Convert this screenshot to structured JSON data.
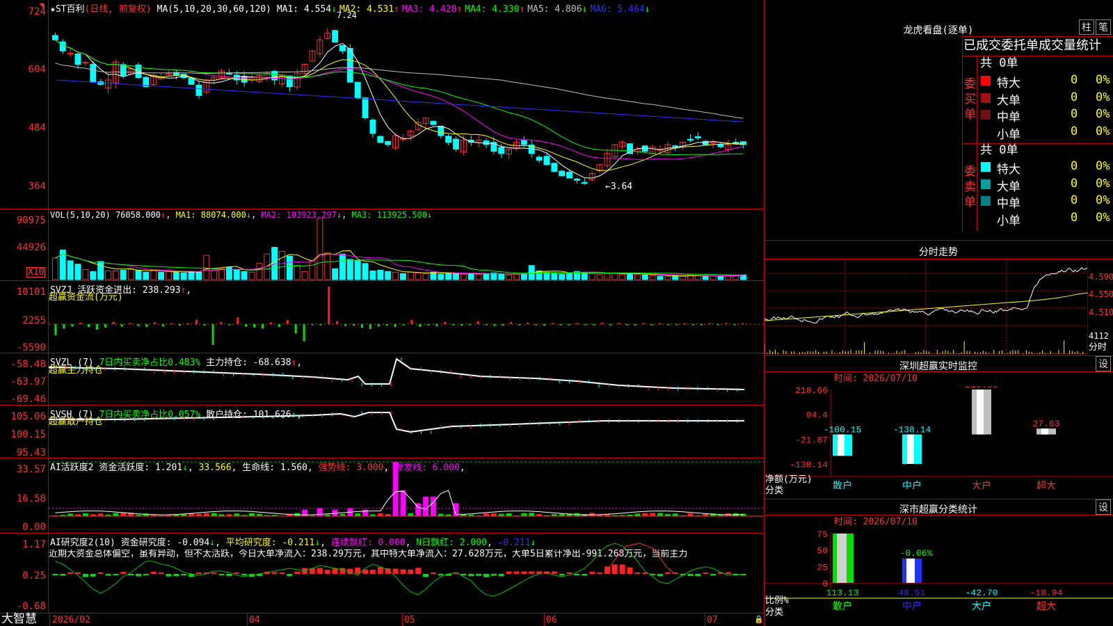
{
  "stock_title": "★ST百利",
  "period_label": "(日线, 前复权)",
  "main_ma_params": "MA(5,10,20,30,60,120)",
  "main_mas": [
    {
      "label": "MA1:",
      "value": "4.554",
      "arrow": "↓",
      "color": "#ffffff"
    },
    {
      "label": "MA2:",
      "value": "4.531",
      "arrow": "↑",
      "color": "#ffff00"
    },
    {
      "label": "MA3:",
      "value": "4.428",
      "arrow": "↑",
      "color": "#ff00ff"
    },
    {
      "label": "MA4:",
      "value": "4.330",
      "arrow": "↑",
      "color": "#00ff00"
    },
    {
      "label": "MA5:",
      "value": "4.806",
      "arrow": "↓",
      "color": "#c0c0c0"
    },
    {
      "label": "MA6:",
      "value": "5.464",
      "arrow": "↓",
      "color": "#3030ff"
    }
  ],
  "high_mark": "7.24",
  "low_mark": "3.64",
  "price_axis": [
    "724",
    "604",
    "484",
    "364"
  ],
  "vol_legend": {
    "name": "VOL(5,10,20)",
    "value": "76058.000",
    "arrow": "↑",
    "ma1": "MA1: 88074.000",
    "ma1_arrow": "↓",
    "ma2": "MA2: 103923.297",
    "ma2_arrow": "↓",
    "ma3": "MA3: 113925.500",
    "ma3_arrow": "↓"
  },
  "vol_axis": [
    "90975",
    "44926"
  ],
  "vol_scale_label": "X10",
  "svzj": {
    "name": "SVZJ",
    "desc": "活跃资金进出: 238.293",
    "arrow": "↑",
    "subtitle": "超赢资金流(万元)",
    "axis": [
      "10101",
      "2255",
      "-5590"
    ]
  },
  "svzl": {
    "name": "SVZL  (7)",
    "desc1": "7日内买卖净占比0.483%",
    "desc2": "主力持仓: -68.638",
    "arrow": "↑",
    "subtitle": "超赢主力持仓",
    "axis": [
      "-58.48",
      "-63.97",
      "-69.46"
    ]
  },
  "svsh": {
    "name": "SVSH  (7)",
    "desc1": "7日内买卖净占比0.057%",
    "desc2": "散户持仓: 101.626",
    "arrow": "↓",
    "subtitle": "超赢散户持仓",
    "axis": [
      "105.06",
      "100.15",
      "95.43"
    ]
  },
  "ai2": {
    "name": "AI活跃度2",
    "l1": "资金活跃度: 1.201",
    "l1_arrow": "↓",
    "l2": "33.566",
    "l3": "生命线: 1.560",
    "l4": "强势线: 3.000",
    "l5": "爆发线: 6.000",
    "axis": [
      "33.57",
      "16.58",
      "0.00"
    ]
  },
  "ai_research": {
    "name": "AI研究度2(10)",
    "l1": "资金研究度: -0.094",
    "l1_arrow": "↓",
    "l2": "平均研究度: -0.211",
    "l2_arrow": "↓",
    "l3": "连续飘红: 0.000",
    "l4": "N日飘红: 2.000",
    "l5": "-0.211",
    "l5_arrow": "↓",
    "comment": "近期大资金总体偏空，虽有异动，但不太活跃，今日大单净流入：238.29万元，其中特大单净流入：27.628万元，大单5日累计净出-991.268万元，当前主力",
    "axis": [
      "1.17",
      "0.25",
      "-0.68"
    ]
  },
  "bottom_axis": {
    "logo": "大智慧",
    "dates": [
      "2026/02",
      "04",
      "05",
      "06",
      "07"
    ]
  },
  "dragon": {
    "title": "龙虎看盘(逐单)",
    "btn1": "柱",
    "btn2": "笔",
    "header": "已成交委托单成交量统计",
    "buy_label": "委买单",
    "sell_label": "委卖单",
    "buy_total": "共 0单",
    "sell_total": "共 0单",
    "buy_rows": [
      {
        "name": "特大",
        "v": "0",
        "p": "0%",
        "color": "#ff0000"
      },
      {
        "name": "大单",
        "v": "0",
        "p": "0%",
        "color": "#a01010"
      },
      {
        "name": "中单",
        "v": "0",
        "p": "0%",
        "color": "#701010"
      },
      {
        "name": "小单",
        "v": "0",
        "p": "0%",
        "color": ""
      }
    ],
    "sell_rows": [
      {
        "name": "特大",
        "v": "0",
        "p": "0%",
        "color": "#00ffff"
      },
      {
        "name": "大单",
        "v": "0",
        "p": "0%",
        "color": "#00a0a0"
      },
      {
        "name": "中单",
        "v": "0",
        "p": "0%",
        "color": "#008080"
      },
      {
        "name": "小单",
        "v": "0",
        "p": "0%",
        "color": ""
      }
    ]
  },
  "intraday": {
    "title": "分时走势",
    "axis": [
      "4.590",
      "4.550",
      "4.510"
    ],
    "vol_label": "4112",
    "vol_unit": "分时"
  },
  "monitor": {
    "title": "深圳超赢实时监控",
    "btn": "设",
    "time": "时间: 2026/07/10",
    "axis": [
      "210.66",
      "94.4",
      "-21.87",
      "-138.14"
    ],
    "unit_label": "净额(万元)",
    "cat_label": "分类",
    "categories": [
      "散户",
      "中户",
      "大户",
      "超大"
    ],
    "values": [
      "-100.15",
      "-138.14",
      "210.66",
      "27.63"
    ]
  },
  "classify": {
    "title": "深市超赢分类统计",
    "btn": "设",
    "time": "时间: 2026/07/10",
    "axis": [
      "75",
      "50",
      "25",
      "0"
    ],
    "mid_label": "-0.06%",
    "unit_label": "比例%",
    "cat_label": "分类",
    "categories": [
      "散户",
      "中户",
      "大户",
      "超大"
    ],
    "values": [
      "113.13",
      "48.51",
      "-42.70",
      "-18.94"
    ]
  },
  "chart_data": [
    {
      "type": "candlestick",
      "title": "★ST百利 (日线, 前复权)",
      "ylim": [
        3.5,
        7.4
      ],
      "y_ticks": [
        7.24,
        6.04,
        4.84,
        3.64
      ],
      "annotations": [
        {
          "text": "7.24",
          "kind": "high"
        },
        {
          "text": "3.64",
          "kind": "low"
        }
      ],
      "close": [
        6.85,
        6.6,
        6.55,
        6.3,
        6.35,
        5.9,
        5.85,
        5.95,
        6.35,
        6.05,
        6.2,
        6.0,
        5.8,
        6.05,
        6.0,
        6.1,
        6.05,
        6.0,
        5.85,
        5.6,
        5.95,
        6.0,
        6.15,
        6.1,
        5.95,
        5.9,
        6.0,
        6.05,
        6.1,
        5.95,
        6.05,
        5.8,
        6.1,
        6.3,
        6.6,
        6.85,
        7.0,
        6.8,
        6.6,
        5.9,
        5.55,
        5.1,
        4.75,
        4.55,
        4.5,
        4.7,
        4.65,
        4.8,
        5.0,
        5.1,
        4.95,
        4.7,
        4.55,
        4.4,
        4.6,
        4.55,
        4.6,
        4.5,
        4.35,
        4.3,
        4.4,
        4.55,
        4.5,
        4.3,
        4.15,
        4.05,
        3.9,
        3.8,
        3.75,
        3.7,
        3.64,
        3.85,
        4.05,
        4.3,
        4.5,
        4.55,
        4.3,
        4.4,
        4.35,
        4.45,
        4.4,
        4.5,
        4.45,
        4.55,
        4.6,
        4.65,
        4.5,
        4.55,
        4.45,
        4.5,
        4.55,
        4.5
      ]
    },
    {
      "type": "bar",
      "title": "VOL(5,10,20)",
      "values": [
        32000,
        44000,
        28000,
        23000,
        15000,
        12000,
        27000,
        13000,
        13000,
        14000,
        15000,
        14000,
        11000,
        14000,
        11000,
        12000,
        11000,
        10000,
        12000,
        11000,
        36000,
        14000,
        16000,
        18000,
        14000,
        12000,
        11000,
        24000,
        38000,
        48000,
        42000,
        35000,
        21000,
        12000,
        28000,
        91000,
        40000,
        16000,
        38000,
        30000,
        28000,
        24000,
        13000,
        14000,
        12000,
        11000,
        9000,
        11000,
        10000,
        9000,
        11000,
        8000,
        10000,
        9000,
        8000,
        9000,
        8000,
        9000,
        10000,
        8000,
        7000,
        8000,
        9000,
        21000,
        13000,
        11000,
        9000,
        8000,
        10000,
        12000,
        11000,
        9000,
        8000,
        9000,
        10000,
        8000,
        9000,
        8000,
        7000,
        6000,
        5000,
        5000,
        6000,
        5000,
        7000,
        6000,
        5000,
        6000,
        5000,
        7000,
        6000,
        7000
      ],
      "ylim": [
        0,
        95000
      ],
      "y_ticks": [
        90975,
        44926
      ]
    },
    {
      "type": "bar",
      "title": "超赢资金流(万元)",
      "values": [
        -3000,
        -1200,
        -600,
        400,
        -800,
        -1500,
        -900,
        600,
        -700,
        300,
        -500,
        -800,
        500,
        -600,
        300,
        -400,
        200,
        1200,
        -400,
        -5590,
        600,
        -300,
        1800,
        -700,
        -900,
        -1200,
        500,
        -800,
        1100,
        -2500,
        -4600,
        -200,
        -300,
        10101,
        800,
        -500,
        -400,
        -1000,
        -1300,
        -600,
        -400,
        -800,
        -300,
        1100,
        -700,
        -300,
        -500,
        600,
        -300,
        -400,
        -200,
        800,
        -300,
        -500,
        -400,
        600,
        -300,
        400,
        -200,
        -400,
        300,
        -300,
        -200,
        300,
        -200,
        -300,
        400,
        -200,
        300,
        -200,
        -300,
        200,
        -200,
        300,
        -200,
        -100,
        200,
        -200,
        -300,
        200,
        -100,
        200,
        -100,
        238
      ],
      "ylim": [
        -5590,
        10101
      ]
    },
    {
      "type": "line",
      "title": "超赢主力持仓",
      "ylim": [
        -69.46,
        -58.48
      ]
    },
    {
      "type": "line",
      "title": "超赢散户持仓",
      "ylim": [
        95.43,
        105.06
      ]
    },
    {
      "type": "bar",
      "title": "AI活跃度2",
      "ylim": [
        0,
        33.57
      ]
    },
    {
      "type": "bar",
      "title": "AI研究度2(10)",
      "ylim": [
        -0.68,
        1.17
      ]
    },
    {
      "type": "bar",
      "title": "深圳超赢实时监控",
      "categories": [
        "散户",
        "中户",
        "大户",
        "超大"
      ],
      "values": [
        -100.15,
        -138.14,
        210.66,
        27.63
      ],
      "ylim": [
        -138.14,
        210.66
      ]
    },
    {
      "type": "bar",
      "title": "深市超赢分类统计",
      "categories": [
        "散户",
        "中户",
        "大户",
        "超大"
      ],
      "values": [
        113.13,
        48.51,
        -42.7,
        -18.94
      ],
      "ylim": [
        0,
        75
      ]
    }
  ]
}
